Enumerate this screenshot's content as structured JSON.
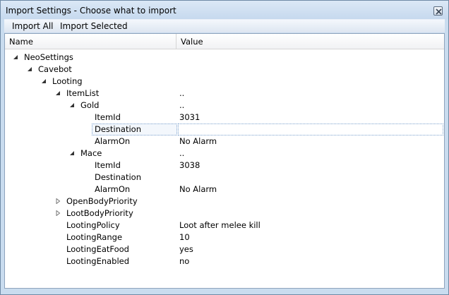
{
  "window": {
    "title": "Import Settings - Choose what to import"
  },
  "menu": {
    "import_all": "Import All",
    "import_selected": "Import Selected"
  },
  "columns": {
    "name": "Name",
    "value": "Value"
  },
  "tree": {
    "neosettings": "NeoSettings",
    "cavebot": "Cavebot",
    "looting": "Looting",
    "itemlist": {
      "label": "ItemList",
      "value": ".."
    },
    "gold": {
      "label": "Gold",
      "value": ".."
    },
    "gold_itemid": {
      "label": "ItemId",
      "value": "3031"
    },
    "gold_destination": {
      "label": "Destination",
      "value": ""
    },
    "gold_alarmon": {
      "label": "AlarmOn",
      "value": "No Alarm"
    },
    "mace": {
      "label": "Mace",
      "value": ".."
    },
    "mace_itemid": {
      "label": "ItemId",
      "value": "3038"
    },
    "mace_destination": {
      "label": "Destination",
      "value": ""
    },
    "mace_alarmon": {
      "label": "AlarmOn",
      "value": "No Alarm"
    },
    "openbodypriority": "OpenBodyPriority",
    "lootbodypriority": "LootBodyPriority",
    "lootingpolicy": {
      "label": "LootingPolicy",
      "value": "Loot after melee kill"
    },
    "lootingrange": {
      "label": "LootingRange",
      "value": "10"
    },
    "lootingeatfood": {
      "label": "LootingEatFood",
      "value": "yes"
    },
    "lootingenabled": {
      "label": "LootingEnabled",
      "value": "no"
    }
  },
  "icons": {
    "expanded": "expanded-triangle-icon",
    "collapsed": "collapsed-triangle-icon",
    "close": "close-icon"
  }
}
